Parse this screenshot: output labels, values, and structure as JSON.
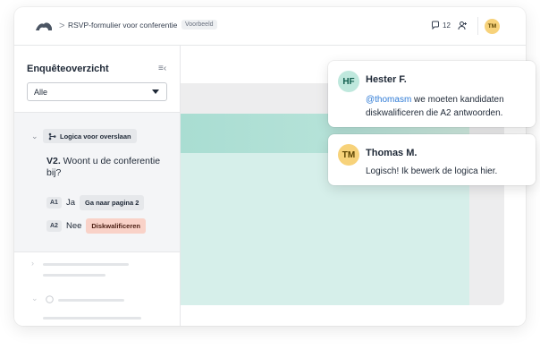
{
  "header": {
    "breadcrumb_separator": ">",
    "title": "RSVP-formulier voor conferentie",
    "badge": "Voorbeeld",
    "comment_count": "12",
    "user_initials": "TM"
  },
  "sidebar": {
    "title": "Enquêteoverzicht",
    "filter_value": "Alle",
    "logic_chip": "Logica voor overslaan",
    "question_number": "V2.",
    "question_text": " Woont u de conferentie bij?",
    "answers": [
      {
        "code": "A1",
        "label": "Ja",
        "action": "Ga naar pagina 2",
        "action_color": "#e6e8eb",
        "action_text_color": "#1f2937"
      },
      {
        "code": "A2",
        "label": "Nee",
        "action": "Diskwalificeren",
        "action_color": "#f9d2c8",
        "action_text_color": "#4a1d12"
      }
    ]
  },
  "comments": [
    {
      "initials": "HF",
      "name": "Hester F.",
      "mention": "@thomasm",
      "text_line1": " we moeten kandidaten",
      "text_line2": "diskwalificeren die A2 antwoorden.",
      "avatar_color": "#bfe8dd",
      "avatar_text_color": "#115e4e"
    },
    {
      "initials": "TM",
      "name": "Thomas M.",
      "text": "Logisch! Ik bewerk de logica hier.",
      "avatar_color": "#f7d27a",
      "avatar_text_color": "#5a4300"
    }
  ]
}
